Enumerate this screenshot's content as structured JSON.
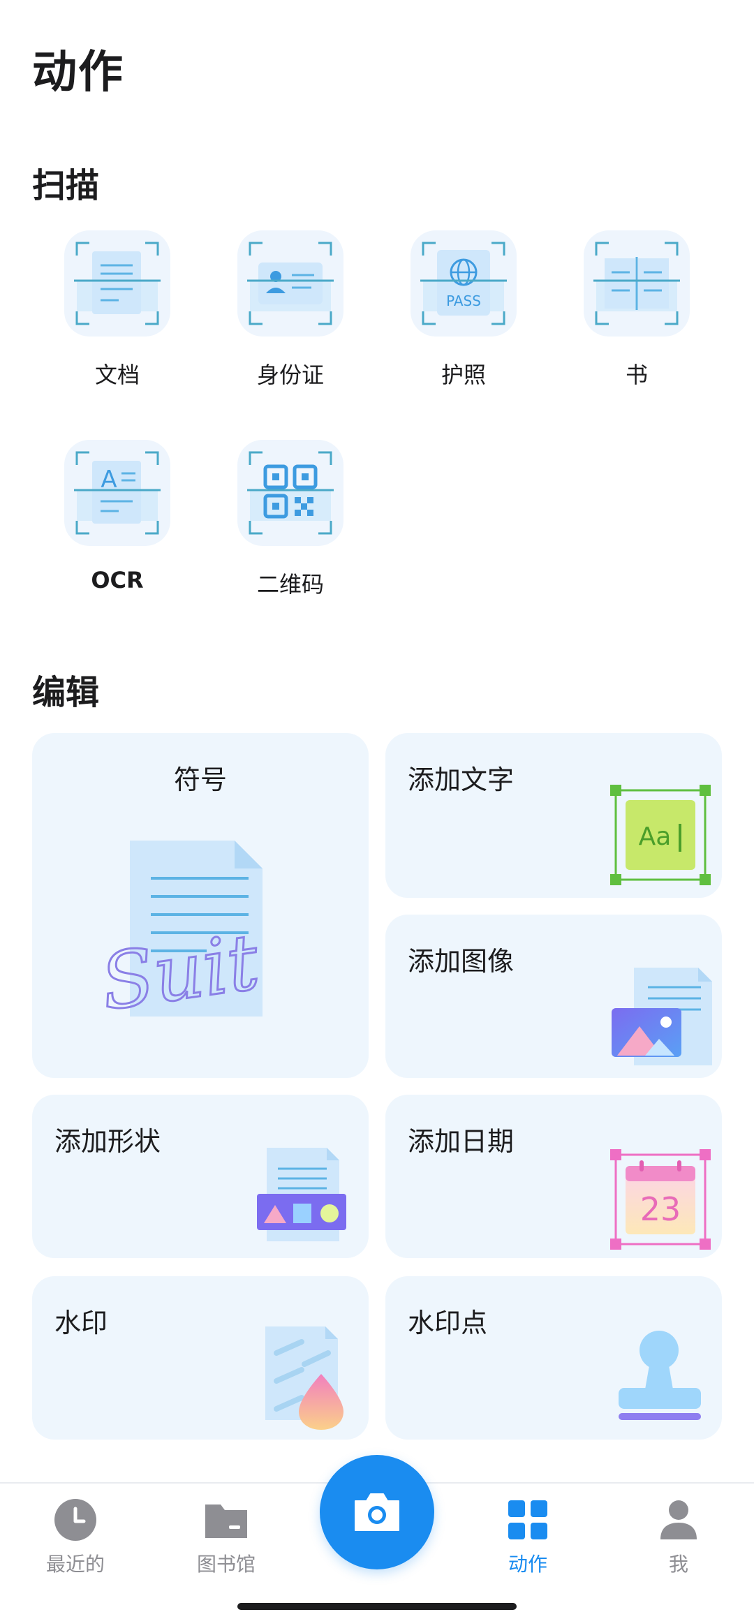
{
  "header": {
    "title": "动作"
  },
  "scan": {
    "title": "扫描",
    "items": [
      {
        "label": "文档",
        "icon": "document-scan-icon"
      },
      {
        "label": "身份证",
        "icon": "id-card-scan-icon"
      },
      {
        "label": "护照",
        "icon": "passport-scan-icon",
        "badge": "PASS"
      },
      {
        "label": "书",
        "icon": "book-scan-icon"
      },
      {
        "label": "OCR",
        "icon": "ocr-scan-icon",
        "glyph": "A"
      },
      {
        "label": "二维码",
        "icon": "qr-code-scan-icon"
      }
    ]
  },
  "edit": {
    "title": "编辑",
    "cards": {
      "signature": {
        "label": "符号",
        "icon": "signature-icon",
        "sign_text": "Suit"
      },
      "add_text": {
        "label": "添加文字",
        "icon": "add-text-icon",
        "sample": "Aa"
      },
      "add_image": {
        "label": "添加图像",
        "icon": "add-image-icon"
      },
      "add_shape": {
        "label": "添加形状",
        "icon": "add-shape-icon"
      },
      "add_date": {
        "label": "添加日期",
        "icon": "add-date-icon",
        "day": "23"
      },
      "watermark": {
        "label": "水印",
        "icon": "watermark-icon"
      },
      "watermark_stamp": {
        "label": "水印点",
        "icon": "stamp-icon"
      }
    }
  },
  "tabbar": {
    "recent": {
      "label": "最近的",
      "icon": "clock-icon"
    },
    "library": {
      "label": "图书馆",
      "icon": "folder-icon"
    },
    "camera": {
      "icon": "camera-icon"
    },
    "actions": {
      "label": "动作",
      "icon": "grid-icon",
      "active": true
    },
    "me": {
      "label": "我",
      "icon": "person-icon"
    }
  },
  "colors": {
    "accent": "#1a8cf0",
    "tile_bg": "#eef5fd",
    "card_bg": "#eef6fd",
    "inactive_tab": "#8e8e93"
  }
}
